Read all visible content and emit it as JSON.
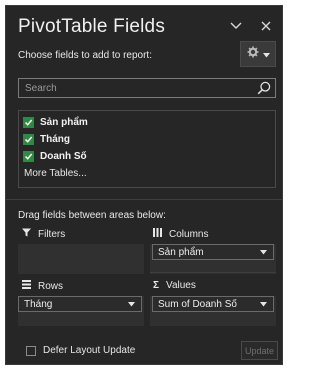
{
  "header": {
    "title": "PivotTable Fields",
    "choose_label": "Choose fields to add to report:"
  },
  "search": {
    "placeholder": "Search"
  },
  "fields": {
    "items": [
      {
        "label": "Sản phẩm",
        "checked": true
      },
      {
        "label": "Tháng",
        "checked": true
      },
      {
        "label": "Doanh Số",
        "checked": true
      }
    ],
    "more_tables": "More Tables..."
  },
  "areas": {
    "hint": "Drag fields between areas below:",
    "filters": {
      "label": "Filters"
    },
    "columns": {
      "label": "Columns",
      "value": "Sản phẩm"
    },
    "rows": {
      "label": "Rows",
      "value": "Tháng"
    },
    "values": {
      "label": "Values",
      "value": "Sum of Doanh Số"
    }
  },
  "footer": {
    "defer_label": "Defer Layout Update",
    "update_label": "Update"
  },
  "colors": {
    "pane_bg": "#262626",
    "checkbox_green": "#2e8a43",
    "text": "#e6e6e6"
  }
}
